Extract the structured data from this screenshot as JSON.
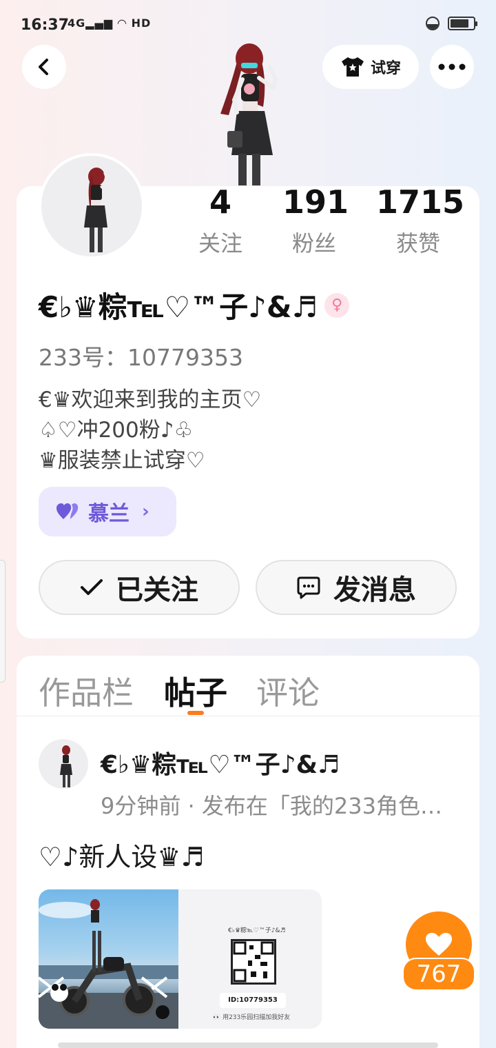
{
  "status_bar": {
    "time": "16:37",
    "network": "4G",
    "hd": "HD"
  },
  "header": {
    "try_on_label": "试穿",
    "icons": {
      "back": "chevron-left-icon",
      "more": "more-dots-icon",
      "try_on": "tshirt-icon"
    }
  },
  "profile": {
    "stats": [
      {
        "value": "4",
        "label": "关注"
      },
      {
        "value": "191",
        "label": "粉丝"
      },
      {
        "value": "1715",
        "label": "获赞"
      }
    ],
    "nickname": "€♭♛粽℡♡™子♪&♬",
    "gender_symbol": "♀",
    "uid_text": "233号：10779353",
    "bio_lines": [
      "€♛欢迎来到我的主页♡",
      "♤♡冲200粉♪♧",
      "♛服装禁止试穿♡"
    ],
    "guild_label": "慕兰",
    "follow_label": "已关注",
    "message_label": "发消息"
  },
  "tabs": [
    {
      "label": "作品栏",
      "active": false
    },
    {
      "label": "帖子",
      "active": true
    },
    {
      "label": "评论",
      "active": false
    }
  ],
  "post": {
    "author": "€♭♛粽℡♡™子♪&♬",
    "meta": "9分钟前 · 发布在「我的233角色…",
    "text": "♡♪新人设♛♬",
    "card_name": "€♭♛粽℡♡™子♪&♬",
    "card_id": "ID:10779353",
    "card_hint": "👀 用233乐园扫描加我好友",
    "like_count": "767"
  },
  "colors": {
    "accent": "#ff8a12",
    "guild_bg": "#ece8fd",
    "guild_text": "#6d5ad9",
    "gender_pink": "#f2789a"
  }
}
